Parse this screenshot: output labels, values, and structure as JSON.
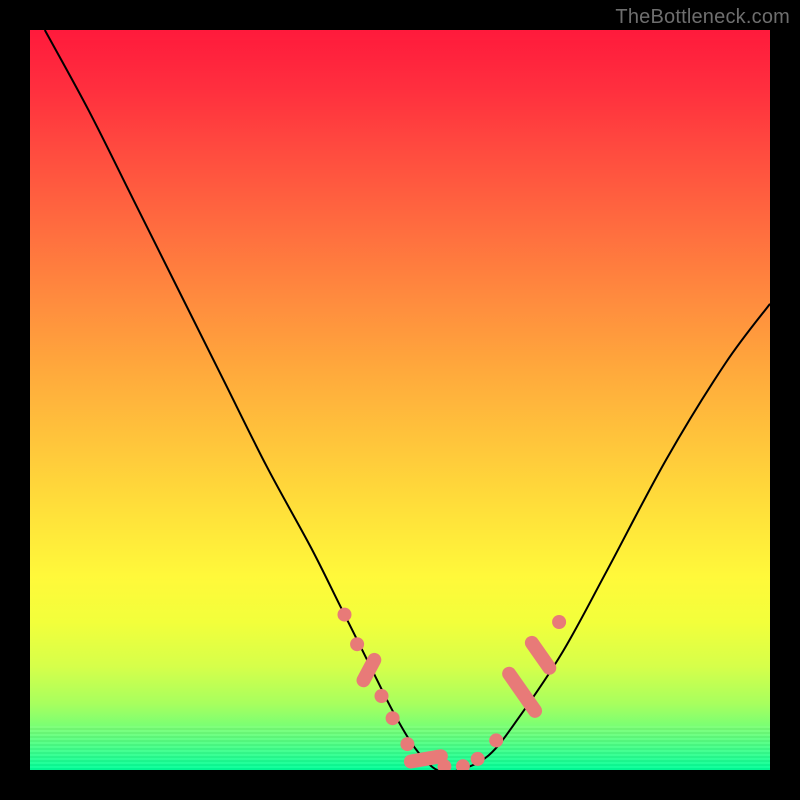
{
  "watermark": "TheBottleneck.com",
  "colors": {
    "background": "#000000",
    "dot_fill": "#e87a78",
    "curve_stroke": "#000000"
  },
  "chart_data": {
    "type": "line",
    "title": "",
    "xlabel": "",
    "ylabel": "",
    "xlim": [
      0,
      100
    ],
    "ylim": [
      0,
      100
    ],
    "grid": false,
    "legend": false,
    "series": [
      {
        "name": "bottleneck-curve",
        "x": [
          2,
          8,
          14,
          20,
          26,
          32,
          38,
          42,
          46,
          49,
          52,
          55,
          58,
          62,
          66,
          72,
          78,
          86,
          94,
          100
        ],
        "y": [
          100,
          89,
          77,
          65,
          53,
          41,
          30,
          22,
          14,
          8,
          3,
          0,
          0,
          2,
          7,
          16,
          27,
          42,
          55,
          63
        ]
      }
    ],
    "markers": [
      {
        "name": "left-upper-dot",
        "kind": "dot",
        "x": 42.5,
        "y": 21
      },
      {
        "name": "left-dot-2",
        "kind": "dot",
        "x": 44.2,
        "y": 17
      },
      {
        "name": "left-pill-1",
        "kind": "pill",
        "x": 45.8,
        "y": 13.5,
        "angle": -62,
        "len": 5
      },
      {
        "name": "left-dot-3",
        "kind": "dot",
        "x": 47.5,
        "y": 10
      },
      {
        "name": "left-dot-4",
        "kind": "dot",
        "x": 49.0,
        "y": 7
      },
      {
        "name": "bottom-dot-1",
        "kind": "dot",
        "x": 51.0,
        "y": 3.5
      },
      {
        "name": "bottom-pill-1",
        "kind": "pill",
        "x": 53.5,
        "y": 1.5,
        "angle": -10,
        "len": 6
      },
      {
        "name": "bottom-dot-2",
        "kind": "dot",
        "x": 56.0,
        "y": 0.5
      },
      {
        "name": "bottom-dot-3",
        "kind": "dot",
        "x": 58.5,
        "y": 0.5
      },
      {
        "name": "bottom-dot-4",
        "kind": "dot",
        "x": 60.5,
        "y": 1.5
      },
      {
        "name": "right-dot-1",
        "kind": "dot",
        "x": 63.0,
        "y": 4
      },
      {
        "name": "right-pill-1",
        "kind": "pill",
        "x": 66.5,
        "y": 10.5,
        "angle": 55,
        "len": 8
      },
      {
        "name": "right-pill-2",
        "kind": "pill",
        "x": 69.0,
        "y": 15.5,
        "angle": 55,
        "len": 6
      },
      {
        "name": "right-dot-2",
        "kind": "dot",
        "x": 71.5,
        "y": 20
      }
    ]
  }
}
